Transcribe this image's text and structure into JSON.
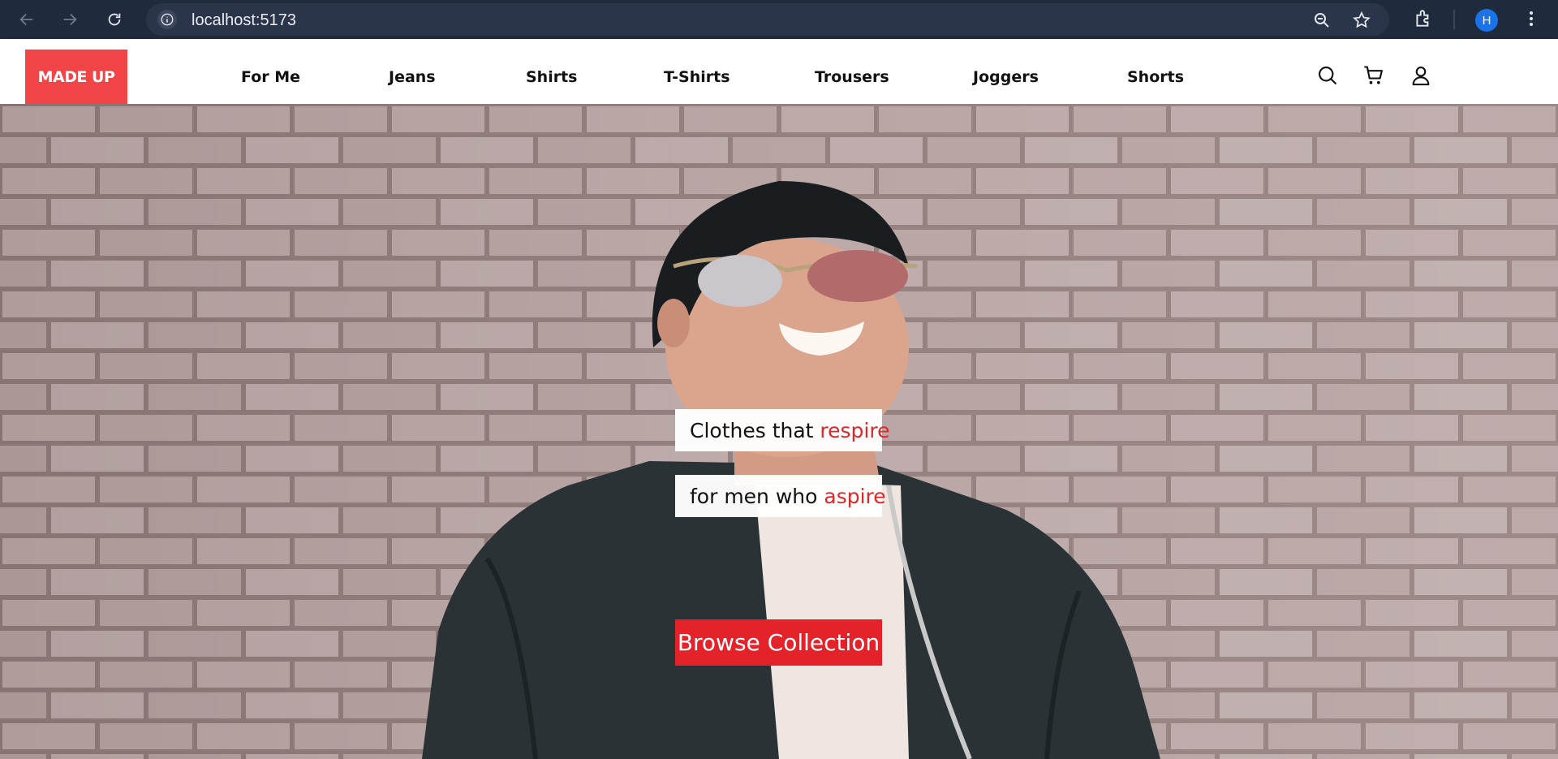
{
  "browser": {
    "url": "localhost:5173",
    "profile_initial": "H",
    "icons": [
      "back-icon",
      "forward-icon",
      "reload-icon",
      "site-info-icon",
      "zoom-icon",
      "bookmark-star-icon",
      "extensions-icon",
      "menu-kebab-icon"
    ]
  },
  "header": {
    "logo": "MADE UP",
    "nav": [
      "For Me",
      "Jeans",
      "Shirts",
      "T-Shirts",
      "Trousers",
      "Joggers",
      "Shorts"
    ],
    "icons": [
      "search-icon",
      "cart-icon",
      "user-icon"
    ]
  },
  "hero": {
    "line1_prefix": "Clothes that ",
    "line1_accent": "respire",
    "line2_prefix": "for men who ",
    "line2_accent": "aspire",
    "cta_label": "Browse Collection"
  },
  "colors": {
    "browser_bar": "#202a3d",
    "brand_red": "#f04446",
    "accent_red": "#e0262b",
    "cta_red": "#e3222a"
  }
}
